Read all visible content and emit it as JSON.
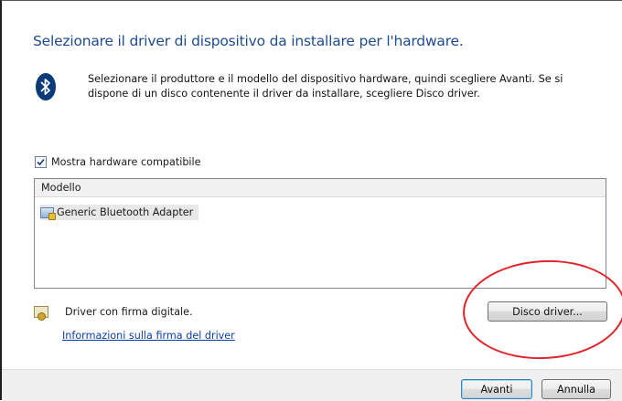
{
  "dialog": {
    "title": "Selezionare il driver di dispositivo da installare per l'hardware.",
    "description": "Selezionare il produttore e il modello del dispositivo hardware, quindi scegliere Avanti. Se si dispone di un disco contenente il driver da installare, scegliere Disco driver.",
    "icon": "bluetooth-icon"
  },
  "compatible_checkbox": {
    "label": "Mostra hardware compatibile",
    "checked": true
  },
  "model_list": {
    "header": "Modello",
    "items": [
      {
        "label": "Generic Bluetooth Adapter",
        "icon": "driver-icon",
        "selected": true
      }
    ]
  },
  "signature": {
    "label": "Driver con firma digitale.",
    "link": "Informazioni sulla firma del driver",
    "icon": "certificate-icon"
  },
  "buttons": {
    "disk": "Disco driver...",
    "next": "Avanti",
    "cancel": "Annulla"
  },
  "annotation": {
    "color": "#e0242a",
    "shape": "ellipse"
  },
  "colors": {
    "title": "#1e4b8e",
    "link": "#0b3fa6",
    "bluetooth": "#0a3a7a"
  }
}
